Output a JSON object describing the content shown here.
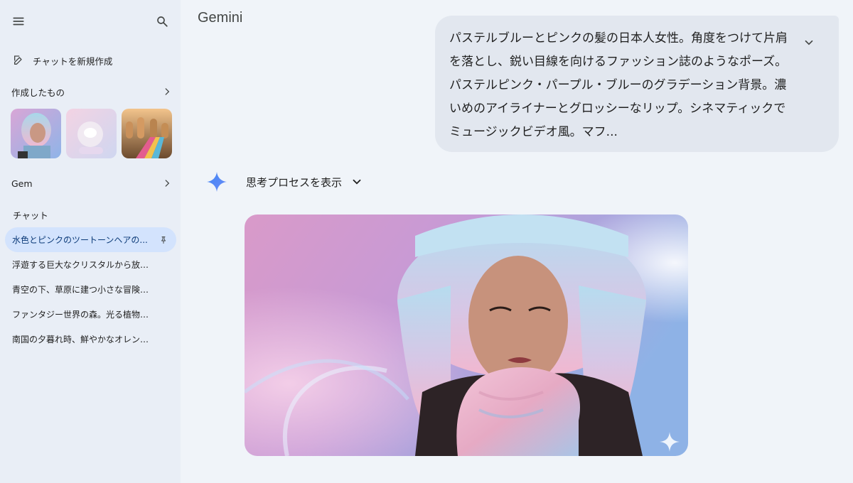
{
  "sidebar": {
    "new_chat_label": "チャットを新規作成",
    "creations_label": "作成したもの",
    "gem_label": "Gem",
    "chats_label": "チャット",
    "chats": [
      {
        "label": "水色とピンクのツートーンヘアの...",
        "active": true
      },
      {
        "label": "浮遊する巨大なクリスタルから放たれ...",
        "active": false
      },
      {
        "label": "青空の下、草原に建つ小さな冒険者の...",
        "active": false
      },
      {
        "label": "ファンタジー世界の森。光る植物が森...",
        "active": false
      },
      {
        "label": "南国の夕暮れ時、鮮やかなオレンジと...",
        "active": false
      }
    ]
  },
  "main": {
    "brand": "Gemini",
    "user_prompt": "パステルブルーとピンクの髪の日本人女性。角度をつけて片肩を落とし、鋭い目線を向けるファッション誌のようなポーズ。パステルピンク・パープル・ブルーのグラデーション背景。濃いめのアイライナーとグロッシーなリップ。シネマティックでミュージックビデオ風。マフ...",
    "thinking_label": "思考プロセスを表示"
  },
  "colors": {
    "sidebar_bg": "#e9eef6",
    "main_bg": "#f0f4f9",
    "active_chat": "#d3e3fd",
    "bubble_bg": "#e2e7ef",
    "accent": "#4285f4"
  },
  "icons": {
    "menu": "menu-icon",
    "search": "search-icon",
    "new_chat": "edit-icon",
    "chevron_right": "chevron-right-icon",
    "pin": "pin-icon",
    "expand": "chevron-down-icon",
    "gemini": "gemini-spark-icon"
  }
}
